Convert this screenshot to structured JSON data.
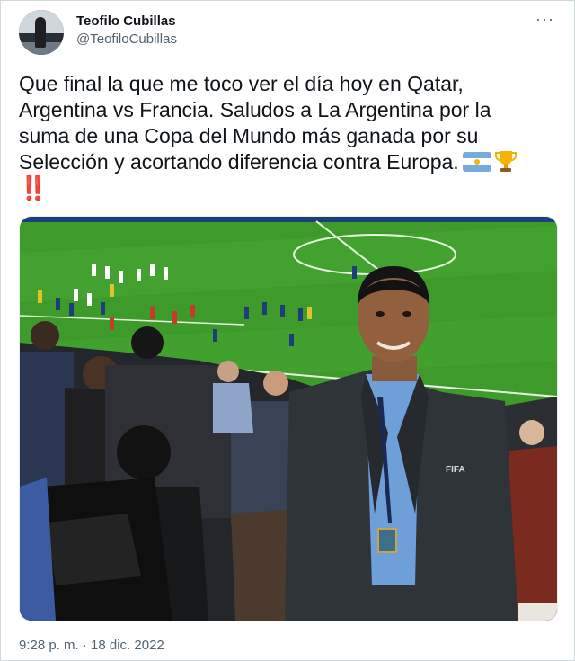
{
  "author": {
    "display_name": "Teofilo Cubillas",
    "handle": "@TeofiloCubillas"
  },
  "tweet": {
    "text_line1": "Que final la que me toco ver el día hoy en Qatar,",
    "text_line2": "Argentina vs Francia. Saludos a La Argentina por la",
    "text_line3": "suma de una Copa del Mundo más ganada por su",
    "text_line4": "Selección y acortando diferencia contra Europa.",
    "exclamation": "‼️",
    "timestamp": "9:28 p. m. · 18 dic. 2022"
  },
  "photo": {
    "jacket_badge": "FIFA"
  },
  "menu": {
    "more_label": "···"
  },
  "colors": {
    "text": "#0f1419",
    "secondary": "#536471",
    "border": "#cfd9de",
    "pitch": "#3f9a2c",
    "flag_blue": "#74acdf"
  },
  "icons": [
    "more-options-icon",
    "argentina-flag-icon",
    "trophy-icon",
    "double-exclamation-icon"
  ]
}
